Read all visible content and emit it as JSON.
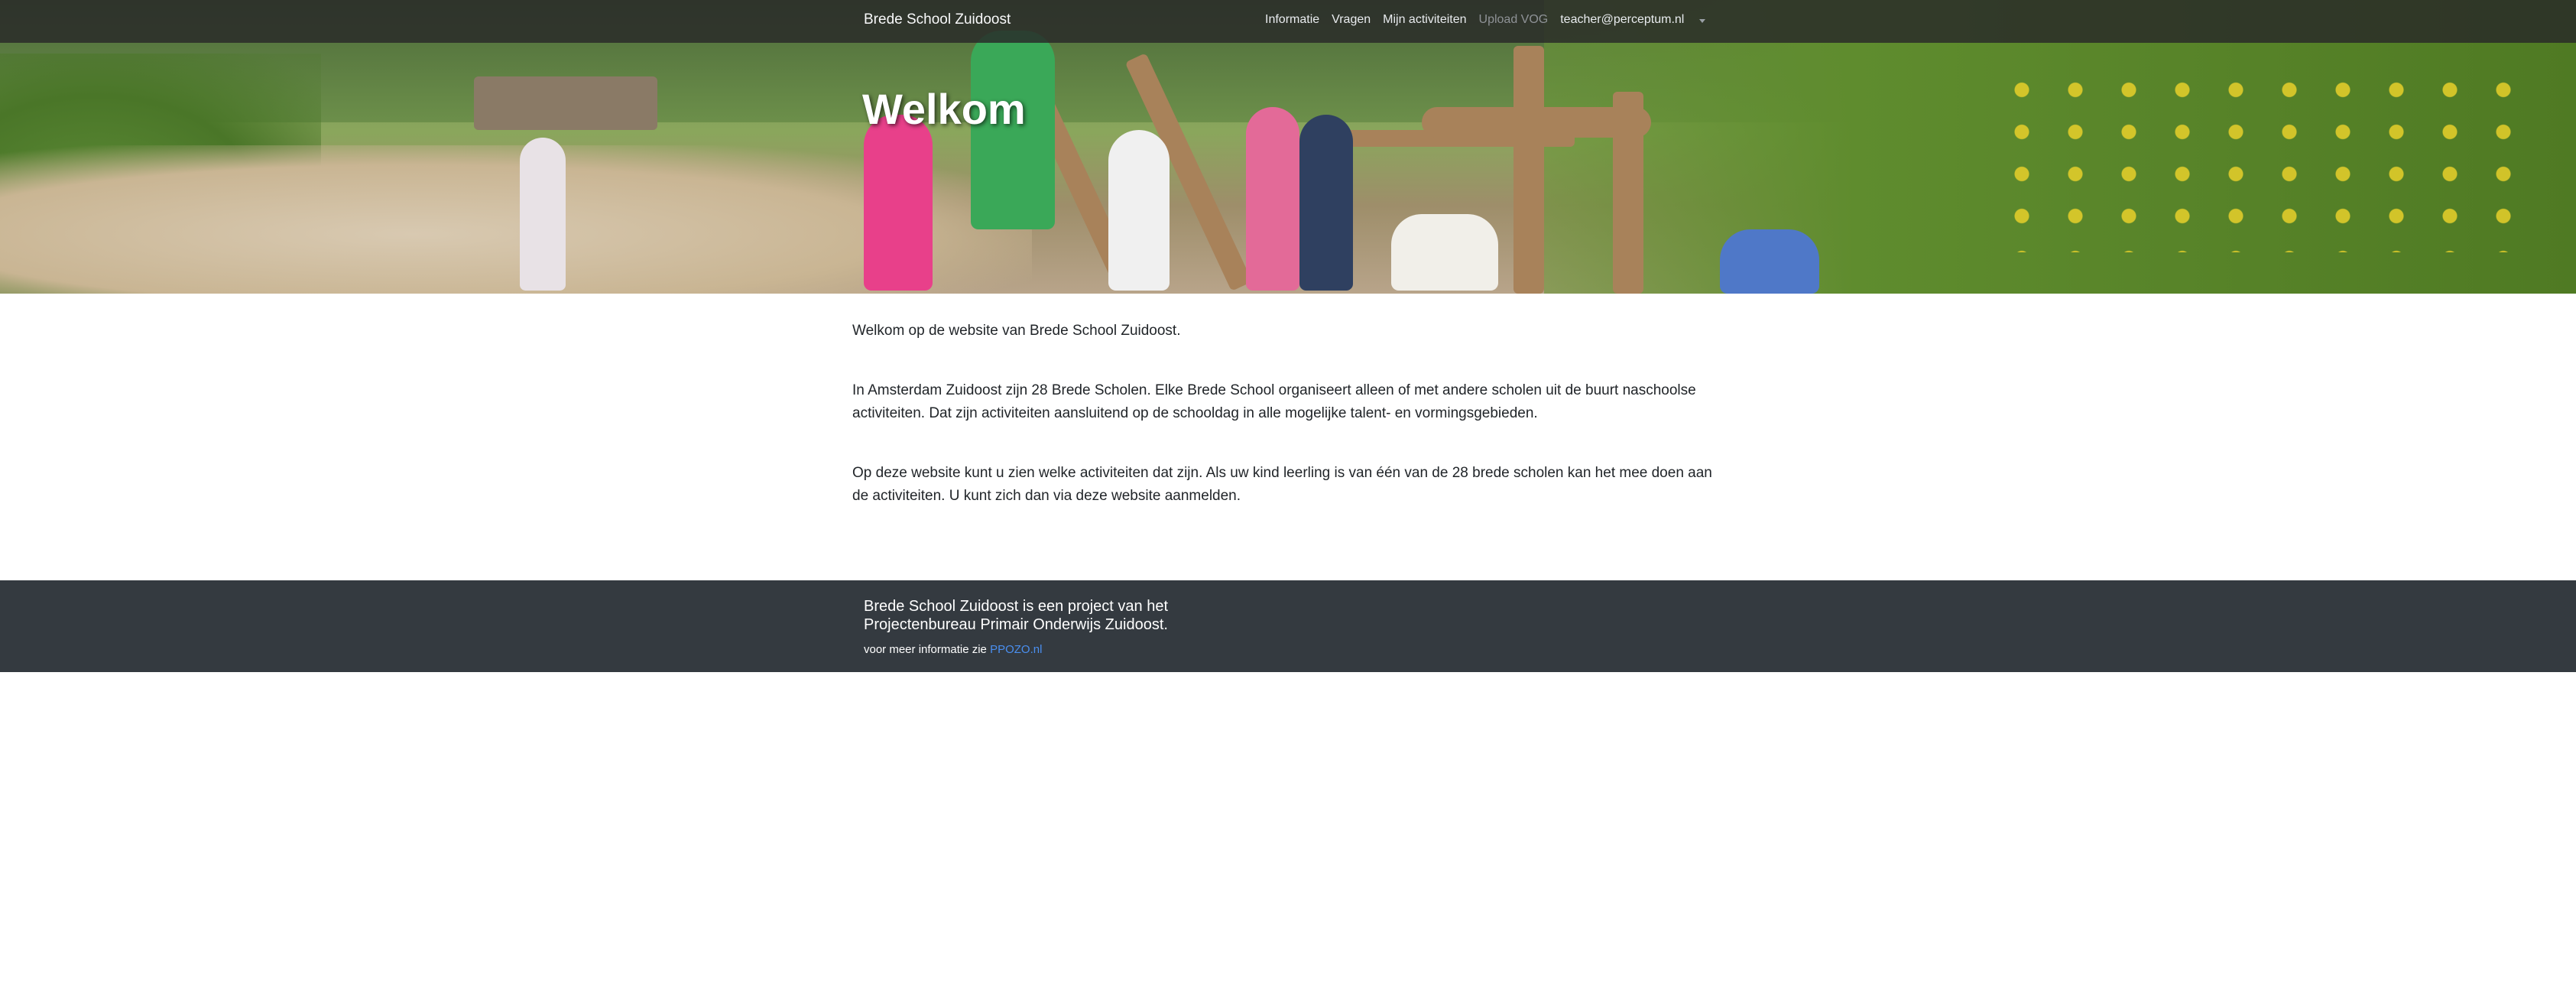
{
  "navbar": {
    "brand": "Brede School Zuidoost",
    "links": [
      {
        "label": "Informatie"
      },
      {
        "label": "Vragen"
      },
      {
        "label": "Mijn activiteiten"
      },
      {
        "label": "Upload VOG"
      },
      {
        "label": "teacher@perceptum.nl"
      }
    ]
  },
  "hero": {
    "title": "Welkom"
  },
  "content": {
    "paragraphs": [
      "Welkom op de website van Brede School Zuidoost.",
      "In Amsterdam Zuidoost zijn 28 Brede Scholen. Elke Brede School organiseert alleen of met andere scholen uit de buurt naschoolse activiteiten. Dat zijn activiteiten aansluitend op de schooldag in alle mogelijke talent- en vormingsgebieden.",
      "Op deze website kunt u zien welke activiteiten dat zijn. Als uw kind leerling is van één van de 28 brede scholen kan het mee doen aan de activiteiten. U kunt zich dan via deze website aanmelden."
    ]
  },
  "footer": {
    "line1": "Brede School Zuidoost is een project van het",
    "line2": "Projectenbureau Primair Onderwijs Zuidoost.",
    "info_prefix": "voor meer informatie zie",
    "link_label": "PPOZO.nl"
  },
  "colors": {
    "footer_bg": "#343a40",
    "link": "#4a8ff0",
    "navbar_bg": "#282828"
  }
}
